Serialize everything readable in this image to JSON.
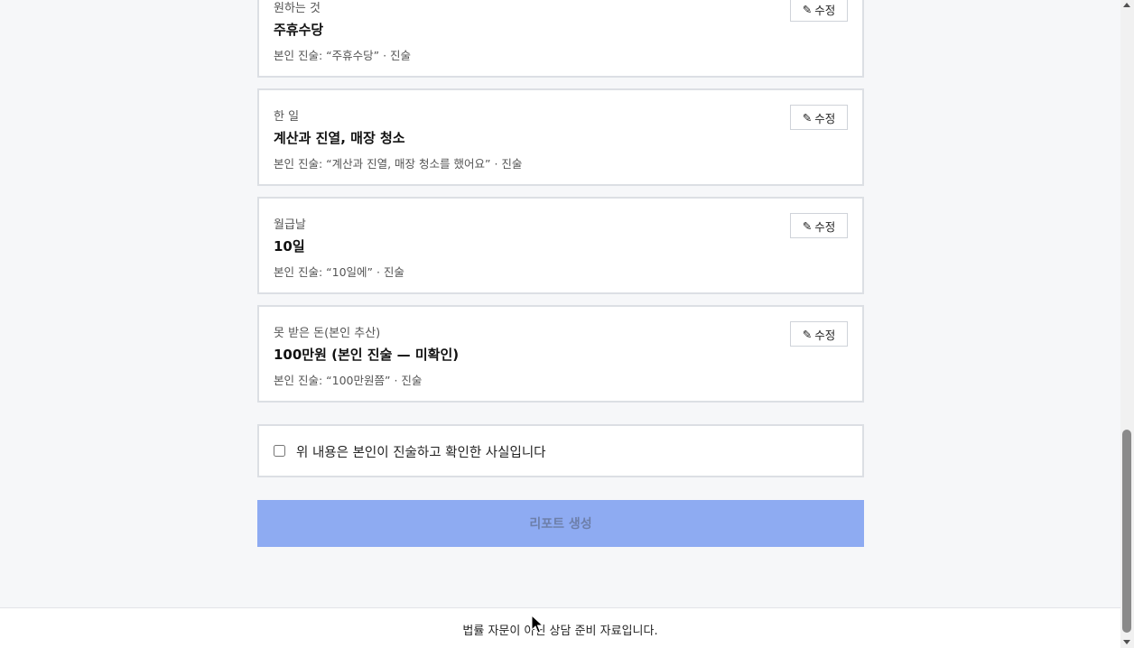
{
  "facts": [
    {
      "label": "원하는 것",
      "value": "주휴수당",
      "statement": "본인 진술: “주휴수당” · 진술",
      "edit_label": "수정"
    },
    {
      "label": "한 일",
      "value": "계산과 진열, 매장 청소",
      "statement": "본인 진술: “계산과 진열, 매장 청소를 했어요” · 진술",
      "edit_label": "수정"
    },
    {
      "label": "월급날",
      "value": "10일",
      "statement": "본인 진술: “10일에” · 진술",
      "edit_label": "수정"
    },
    {
      "label": "못 받은 돈(본인 추산)",
      "value": "100만원 (본인 진술 — 미확인)",
      "statement": "본인 진술: “100만원쯤” · 진술",
      "edit_label": "수정"
    }
  ],
  "edit_icon": "pencil-icon",
  "confirm": {
    "text": "위 내용은 본인이 진술하고 확인한 사실입니다",
    "checked": false
  },
  "report_button": {
    "label": "리포트 생성",
    "disabled": true,
    "color": "#8eabf2"
  },
  "footer": {
    "text": "법률 자문이 아닌 상담 준비 자료입니다."
  }
}
